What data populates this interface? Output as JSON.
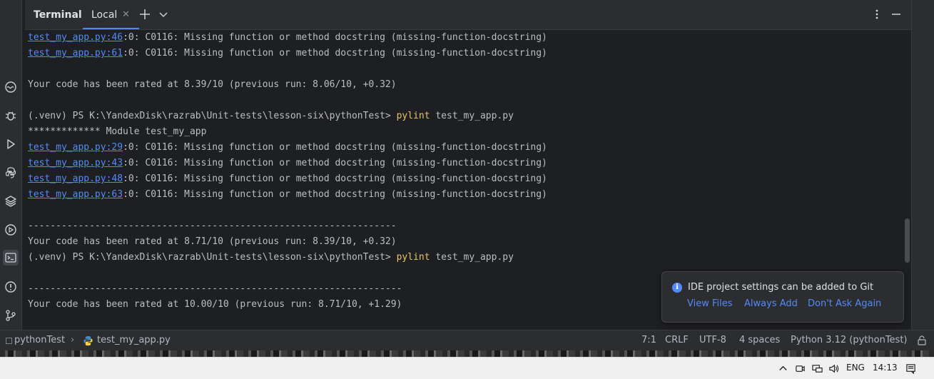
{
  "header": {
    "title": "Terminal",
    "tab_label": "Local"
  },
  "terminal": {
    "lines": [
      {
        "link": "test_my_app.py:46",
        "text": ":0: C0116: Missing function or method docstring (missing-function-docstring)"
      },
      {
        "link": "test_my_app.py:61",
        "text": ":0: C0116: Missing function or method docstring (missing-function-docstring)"
      },
      {
        "text": ""
      },
      {
        "text": "Your code has been rated at 8.39/10 (previous run: 8.06/10, +0.32)"
      },
      {
        "text": ""
      },
      {
        "prompt": "(.venv) PS K:\\YandexDisk\\razrab\\Unit-tests\\lesson-six\\pythonTest> ",
        "cmd": "pylint",
        "args": " test_my_app.py"
      },
      {
        "text": "************* Module test_my_app"
      },
      {
        "link": "test_my_app.py:29",
        "text": ":0: C0116: Missing function or method docstring (missing-function-docstring)"
      },
      {
        "link": "test_my_app.py:43",
        "text": ":0: C0116: Missing function or method docstring (missing-function-docstring)"
      },
      {
        "link": "test_my_app.py:48",
        "text": ":0: C0116: Missing function or method docstring (missing-function-docstring)"
      },
      {
        "link": "test_my_app.py:63",
        "text": ":0: C0116: Missing function or method docstring (missing-function-docstring)"
      },
      {
        "text": ""
      },
      {
        "text": "------------------------------------------------------------------"
      },
      {
        "text": "Your code has been rated at 8.71/10 (previous run: 8.39/10, +0.32)"
      },
      {
        "prompt": "(.venv) PS K:\\YandexDisk\\razrab\\Unit-tests\\lesson-six\\pythonTest> ",
        "cmd": "pylint",
        "args": " test_my_app.py"
      },
      {
        "text": ""
      },
      {
        "text": "-------------------------------------------------------------------"
      },
      {
        "text": "Your code has been rated at 10.00/10 (previous run: 8.71/10, +1.29)"
      }
    ]
  },
  "notification": {
    "message": "IDE project settings can be added to Git",
    "actions": [
      "View Files",
      "Always Add",
      "Don't Ask Again"
    ]
  },
  "status": {
    "project": "pythonTest",
    "file": "test_my_app.py",
    "position": "7:1",
    "line_ending": "CRLF",
    "encoding": "UTF-8",
    "indent": "4 spaces",
    "interpreter": "Python 3.12 (pythonTest)"
  },
  "taskbar": {
    "language": "ENG",
    "time": "14:13"
  },
  "colors": {
    "accent": "#548af7",
    "command": "#e6c567",
    "background": "#1e1f22"
  }
}
